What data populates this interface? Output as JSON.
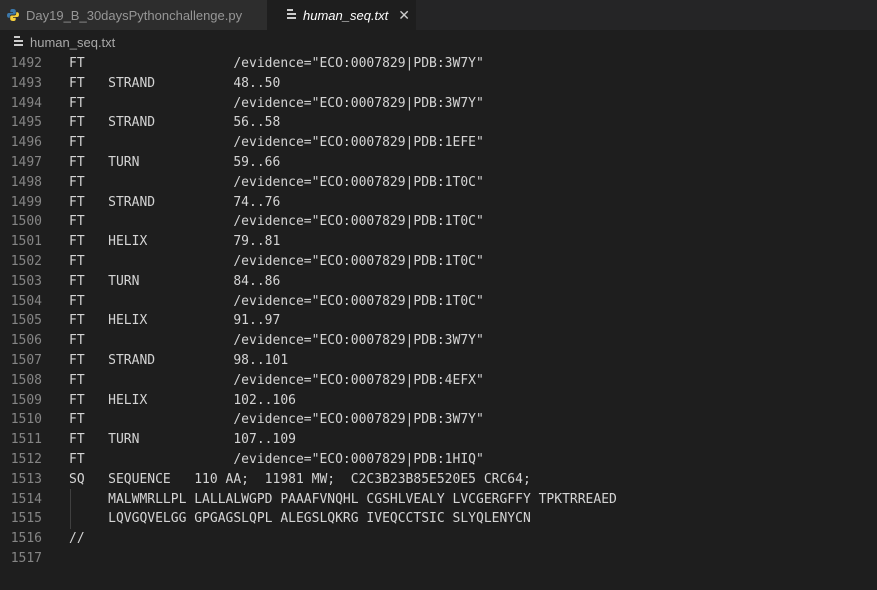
{
  "tabs": [
    {
      "label": "Day19_B_30daysPythonchallenge.py",
      "icon": "python-icon",
      "active": false
    },
    {
      "label": "human_seq.txt",
      "icon": "text-file-icon",
      "active": true,
      "close": "✕"
    }
  ],
  "breadcrumb": {
    "icon": "text-file-icon",
    "label": "human_seq.txt"
  },
  "lines": [
    {
      "no": "1492",
      "text": "FT                   /evidence=\"ECO:0007829|PDB:3W7Y\""
    },
    {
      "no": "1493",
      "text": "FT   STRAND          48..50"
    },
    {
      "no": "1494",
      "text": "FT                   /evidence=\"ECO:0007829|PDB:3W7Y\""
    },
    {
      "no": "1495",
      "text": "FT   STRAND          56..58"
    },
    {
      "no": "1496",
      "text": "FT                   /evidence=\"ECO:0007829|PDB:1EFE\""
    },
    {
      "no": "1497",
      "text": "FT   TURN            59..66"
    },
    {
      "no": "1498",
      "text": "FT                   /evidence=\"ECO:0007829|PDB:1T0C\""
    },
    {
      "no": "1499",
      "text": "FT   STRAND          74..76"
    },
    {
      "no": "1500",
      "text": "FT                   /evidence=\"ECO:0007829|PDB:1T0C\""
    },
    {
      "no": "1501",
      "text": "FT   HELIX           79..81"
    },
    {
      "no": "1502",
      "text": "FT                   /evidence=\"ECO:0007829|PDB:1T0C\""
    },
    {
      "no": "1503",
      "text": "FT   TURN            84..86"
    },
    {
      "no": "1504",
      "text": "FT                   /evidence=\"ECO:0007829|PDB:1T0C\""
    },
    {
      "no": "1505",
      "text": "FT   HELIX           91..97"
    },
    {
      "no": "1506",
      "text": "FT                   /evidence=\"ECO:0007829|PDB:3W7Y\""
    },
    {
      "no": "1507",
      "text": "FT   STRAND          98..101"
    },
    {
      "no": "1508",
      "text": "FT                   /evidence=\"ECO:0007829|PDB:4EFX\""
    },
    {
      "no": "1509",
      "text": "FT   HELIX           102..106"
    },
    {
      "no": "1510",
      "text": "FT                   /evidence=\"ECO:0007829|PDB:3W7Y\""
    },
    {
      "no": "1511",
      "text": "FT   TURN            107..109"
    },
    {
      "no": "1512",
      "text": "FT                   /evidence=\"ECO:0007829|PDB:1HIQ\""
    },
    {
      "no": "1513",
      "text": "SQ   SEQUENCE   110 AA;  11981 MW;  C2C3B23B85E520E5 CRC64;"
    },
    {
      "no": "1514",
      "text": "     MALWMRLLPL LALLALWGPD PAAAFVNQHL CGSHLVEALY LVCGERGFFY TPKTRREAED"
    },
    {
      "no": "1515",
      "text": "     LQVGQVELGG GPGAGSLQPL ALEGSLQKRG IVEQCCTSIC SLYQLENYCN"
    },
    {
      "no": "1516",
      "text": "//"
    },
    {
      "no": "1517",
      "text": ""
    }
  ]
}
